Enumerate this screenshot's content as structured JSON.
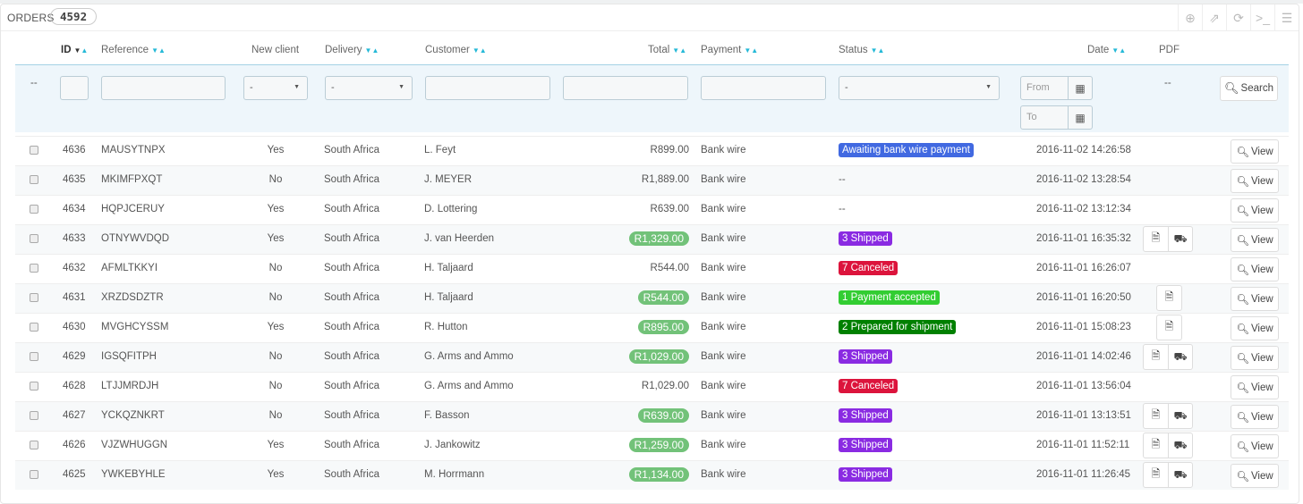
{
  "header": {
    "title": "ORDERS",
    "count": "4592",
    "tools": [
      "add-icon",
      "export-icon",
      "refresh-icon",
      "sql-icon",
      "database-icon"
    ]
  },
  "columns": {
    "id": "ID",
    "reference": "Reference",
    "new_client": "New client",
    "delivery": "Delivery",
    "customer": "Customer",
    "total": "Total",
    "payment": "Payment",
    "status": "Status",
    "date": "Date",
    "pdf": "PDF"
  },
  "filters": {
    "bulk": "--",
    "new_client": "-",
    "delivery": "-",
    "status": "-",
    "from_placeholder": "From",
    "to_placeholder": "To",
    "pdf": "--",
    "search_label": "Search"
  },
  "view_label": "View",
  "colors": {
    "awaiting": "#4169e1",
    "shipped": "#8a2be2",
    "canceled": "#dc143c",
    "accepted": "#32cd32",
    "prepared": "#008000",
    "total_pill": "#72c279"
  },
  "orders": [
    {
      "id": "4636",
      "ref": "MAUSYTNPX",
      "new": "Yes",
      "delivery": "South Africa",
      "customer": "L. Feyt",
      "total": "R899.00",
      "pill": false,
      "payment": "Bank wire",
      "status": "Awaiting bank wire payment",
      "status_color": "#4169e1",
      "date": "2016-11-02 14:26:58",
      "pdf": ""
    },
    {
      "id": "4635",
      "ref": "MKIMFPXQT",
      "new": "No",
      "delivery": "South Africa",
      "customer": "J. MEYER",
      "total": "R1,889.00",
      "pill": false,
      "payment": "Bank wire",
      "status": "--",
      "status_color": "",
      "date": "2016-11-02 13:28:54",
      "pdf": ""
    },
    {
      "id": "4634",
      "ref": "HQPJCERUY",
      "new": "Yes",
      "delivery": "South Africa",
      "customer": "D. Lottering",
      "total": "R639.00",
      "pill": false,
      "payment": "Bank wire",
      "status": "--",
      "status_color": "",
      "date": "2016-11-02 13:12:34",
      "pdf": ""
    },
    {
      "id": "4633",
      "ref": "OTNYWVDQD",
      "new": "Yes",
      "delivery": "South Africa",
      "customer": "J. van Heerden",
      "total": "R1,329.00",
      "pill": true,
      "payment": "Bank wire",
      "status": "3 Shipped",
      "status_color": "#8a2be2",
      "date": "2016-11-01 16:35:32",
      "pdf": "both"
    },
    {
      "id": "4632",
      "ref": "AFMLTKKYI",
      "new": "No",
      "delivery": "South Africa",
      "customer": "H. Taljaard",
      "total": "R544.00",
      "pill": false,
      "payment": "Bank wire",
      "status": "7 Canceled",
      "status_color": "#dc143c",
      "date": "2016-11-01 16:26:07",
      "pdf": ""
    },
    {
      "id": "4631",
      "ref": "XRZDSDZTR",
      "new": "No",
      "delivery": "South Africa",
      "customer": "H. Taljaard",
      "total": "R544.00",
      "pill": true,
      "payment": "Bank wire",
      "status": "1 Payment accepted",
      "status_color": "#32cd32",
      "date": "2016-11-01 16:20:50",
      "pdf": "invoice"
    },
    {
      "id": "4630",
      "ref": "MVGHCYSSM",
      "new": "Yes",
      "delivery": "South Africa",
      "customer": "R. Hutton",
      "total": "R895.00",
      "pill": true,
      "payment": "Bank wire",
      "status": "2 Prepared for shipment",
      "status_color": "#008000",
      "date": "2016-11-01 15:08:23",
      "pdf": "invoice"
    },
    {
      "id": "4629",
      "ref": "IGSQFITPH",
      "new": "No",
      "delivery": "South Africa",
      "customer": "G. Arms and Ammo",
      "total": "R1,029.00",
      "pill": true,
      "payment": "Bank wire",
      "status": "3 Shipped",
      "status_color": "#8a2be2",
      "date": "2016-11-01 14:02:46",
      "pdf": "both"
    },
    {
      "id": "4628",
      "ref": "LTJJMRDJH",
      "new": "No",
      "delivery": "South Africa",
      "customer": "G. Arms and Ammo",
      "total": "R1,029.00",
      "pill": false,
      "payment": "Bank wire",
      "status": "7 Canceled",
      "status_color": "#dc143c",
      "date": "2016-11-01 13:56:04",
      "pdf": ""
    },
    {
      "id": "4627",
      "ref": "YCKQZNKRT",
      "new": "No",
      "delivery": "South Africa",
      "customer": "F. Basson",
      "total": "R639.00",
      "pill": true,
      "payment": "Bank wire",
      "status": "3 Shipped",
      "status_color": "#8a2be2",
      "date": "2016-11-01 13:13:51",
      "pdf": "both"
    },
    {
      "id": "4626",
      "ref": "VJZWHUGGN",
      "new": "Yes",
      "delivery": "South Africa",
      "customer": "J. Jankowitz",
      "total": "R1,259.00",
      "pill": true,
      "payment": "Bank wire",
      "status": "3 Shipped",
      "status_color": "#8a2be2",
      "date": "2016-11-01 11:52:11",
      "pdf": "both"
    },
    {
      "id": "4625",
      "ref": "YWKEBYHLE",
      "new": "Yes",
      "delivery": "South Africa",
      "customer": "M. Horrmann",
      "total": "R1,134.00",
      "pill": true,
      "payment": "Bank wire",
      "status": "3 Shipped",
      "status_color": "#8a2be2",
      "date": "2016-11-01 11:26:45",
      "pdf": "both"
    }
  ]
}
